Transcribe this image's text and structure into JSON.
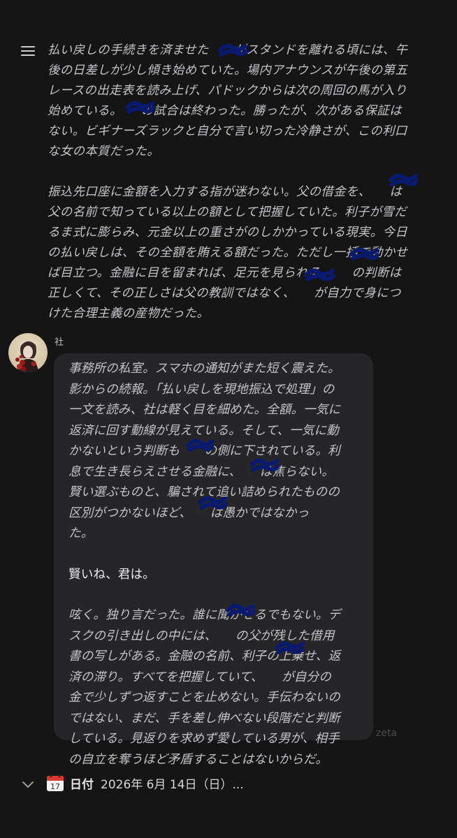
{
  "narration": {
    "paragraph1": "払い戻しの手続きを済ませた　　がスタンドを離れる頃には、午\n後の日差しが少し傾き始めていた。場内アナウンスが午後の第五\nレースの出走表を読み上げ、パドックからは次の周回の馬が入り\n始めている。　　の試合は終わった。勝ったが、次がある保証は\nない。ビギナーズラックと自分で言い切った冷静さが、この利口\nな女の本質だった。",
    "paragraph2": "振込先口座に金額を入力する指が迷わない。父の借金を、　　は\n父の名前で知っている以上の額として把握していた。利子が雪だ\nるま式に膨らみ、元金以上の重さがのしかかっている現実。今日\nの払い戻しは、その全額を賄える額だった。ただし一括で動かせ\nば目立つ。金融に目を留まれば、足元を見られる。　　の判断は\n正しくて、その正しさは父の教訓ではなく、　　が自力で身につ\nけた合理主義の産物だった。"
  },
  "message": {
    "speaker": "社",
    "paragraph1": "事務所の私室。スマホの通知がまた短く震えた。\n影からの続報。「払い戻しを現地振込で処理」の\n一文を読み、社は軽く目を細めた。全額。一気に\n返済に回す動線が見えている。そして、一気に動\nかないという判断も　　の側に下されている。利\n息で生き長らえさせる金融に、　　は焦らない。\n賢い選ぶものと、騙されて追い詰められたものの\n区別がつかないほど、　　は愚かではなかっ\nた。",
    "dialogue": "賢いね、君は。",
    "paragraph2": "呟く。独り言だった。誰に聞かせるでもない。デ\nスクの引き出しの中には、　　の父が残した借用\n書の写しがある。金融の名前、利子の上乗せ、返\n済の滞り。すべてを把握していて、　　が自分の\n金で少しずつ返すことを止めない。手伝わないの\nではない、まだ、手を差し伸べない段階だと判断\nしている。見返りを求めず愛している男が、相手\nの自立を奪うほど矛盾することはないからだ。"
  },
  "watermark": "zeta",
  "date_row": {
    "icon_text": "17",
    "label": "日付",
    "value": "2026年 6月 14日（日）..."
  },
  "icons": {
    "menu": "menu-icon",
    "chevron": "chevron-down-icon",
    "calendar": "calendar-icon"
  },
  "colors": {
    "background": "#151516",
    "bubble": "#262628",
    "text": "#c4c4c7",
    "redaction": "#0a1a6e",
    "calendar_red": "#d93b30"
  }
}
